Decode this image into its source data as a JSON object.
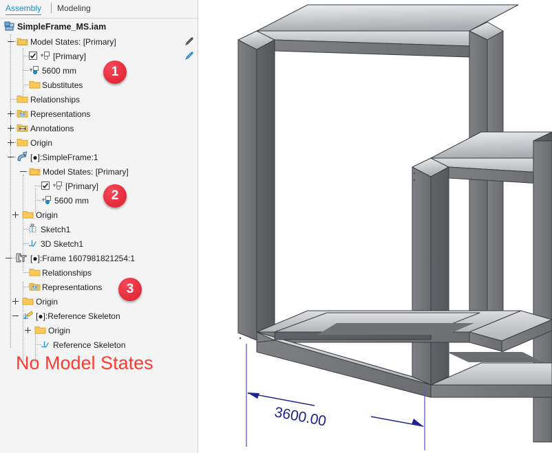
{
  "app": {
    "background": "#ffffff",
    "panel_bg": "#f4f4f4",
    "accent_blue": "#1a8fd1",
    "badge_red": "#e8303f",
    "dim_blue": "#1f1f8f",
    "warning_red": "#ff3b30"
  },
  "tabs": [
    {
      "label": "Assembly",
      "active": true
    },
    {
      "label": "Modeling",
      "active": false
    }
  ],
  "tree": {
    "root": {
      "label": "SimpleFrame_MS.iam",
      "icon": "assembly-document-icon"
    },
    "nodes": [
      {
        "label": "Model States: [Primary]",
        "icon": "open-folder-icon",
        "indent": 1,
        "expander": "minus"
      },
      {
        "label": "[Primary]",
        "icon": "model-state-icon",
        "indent": 2,
        "checkbox": true
      },
      {
        "label": "5600 mm",
        "icon": "model-state-icon",
        "indent": 2
      },
      {
        "label": "Substitutes",
        "icon": "folder-icon",
        "indent": 2
      },
      {
        "label": "Relationships",
        "icon": "folder-icon",
        "indent": 1
      },
      {
        "label": "Representations",
        "icon": "representations-folder-icon",
        "indent": 1,
        "expander": "plus"
      },
      {
        "label": "Annotations",
        "icon": "annotations-folder-icon",
        "indent": 1,
        "expander": "plus"
      },
      {
        "label": "Origin",
        "icon": "folder-icon",
        "indent": 1,
        "expander": "plus"
      },
      {
        "label": "[●]:SimpleFrame:1",
        "icon": "part-occurrence-icon",
        "indent": 1,
        "expander": "minus"
      },
      {
        "label": "Model States: [Primary]",
        "icon": "open-folder-icon",
        "indent": 2,
        "expander": "minus"
      },
      {
        "label": "[Primary]",
        "icon": "model-state-icon",
        "indent": 3,
        "checkbox": true
      },
      {
        "label": "5600 mm",
        "icon": "model-state-icon",
        "indent": 3
      },
      {
        "label": "Origin",
        "icon": "folder-icon",
        "indent": 2,
        "expander": "plus"
      },
      {
        "label": "Sketch1",
        "icon": "sketch-icon",
        "indent": 2
      },
      {
        "label": "3D Sketch1",
        "icon": "sketch-3d-icon",
        "indent": 2
      },
      {
        "label": "[●]:Frame 1607981821254:1",
        "icon": "frame-assembly-icon",
        "indent": 1,
        "expander": "minus"
      },
      {
        "label": "Relationships",
        "icon": "folder-icon",
        "indent": 2
      },
      {
        "label": "Representations",
        "icon": "representations-folder-icon",
        "indent": 2
      },
      {
        "label": "Origin",
        "icon": "folder-icon",
        "indent": 2,
        "expander": "plus"
      },
      {
        "label": "[●]:Reference Skeleton",
        "icon": "reference-skeleton-icon",
        "indent": 2,
        "expander": "minus"
      },
      {
        "label": "Origin",
        "icon": "folder-icon",
        "indent": 3,
        "expander": "plus"
      },
      {
        "label": "Reference Skeleton",
        "icon": "sketch-3d-icon",
        "indent": 3
      }
    ]
  },
  "badges": [
    {
      "number": "1"
    },
    {
      "number": "2"
    },
    {
      "number": "3"
    }
  ],
  "edit_icons": [
    {
      "name": "pencil-icon-gray",
      "color": "#4a4a4a"
    },
    {
      "name": "pencil-icon-blue",
      "color": "#2196f3"
    }
  ],
  "annotation": {
    "no_model_states": "No Model States"
  },
  "viewport": {
    "dimension_value": "3600.00",
    "model_name": "SimpleFrame",
    "shading": {
      "light": "#e9eaec",
      "mid": "#b3b6ba",
      "dark": "#77797c",
      "darker": "#64666a",
      "edge": "#3a3c3f"
    }
  }
}
